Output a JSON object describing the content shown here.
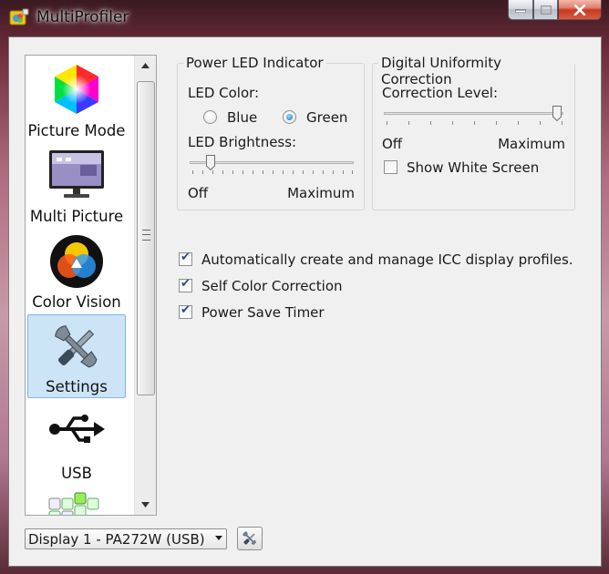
{
  "window": {
    "title": "MultiProfiler",
    "controls": {
      "minimize_icon": "minimize-icon",
      "maximize_icon": "maximize-icon",
      "close_icon": "close-icon"
    }
  },
  "nav": {
    "items": [
      {
        "label": "Picture Mode",
        "icon": "color-hexagon-icon",
        "selected": false
      },
      {
        "label": "Multi Picture",
        "icon": "monitor-icon",
        "selected": false
      },
      {
        "label": "Color Vision",
        "icon": "color-vision-icon",
        "selected": false
      },
      {
        "label": "Settings",
        "icon": "wrench-screwdriver-icon",
        "selected": true
      },
      {
        "label": "USB",
        "icon": "usb-icon",
        "selected": false
      }
    ]
  },
  "power_led": {
    "group_title": "Power LED Indicator",
    "color_label": "LED Color:",
    "options": [
      {
        "label": "Blue",
        "selected": false
      },
      {
        "label": "Green",
        "selected": true
      }
    ],
    "brightness_label": "LED Brightness:",
    "brightness_min": "Off",
    "brightness_max": "Maximum",
    "brightness_level": 0.12
  },
  "uniformity": {
    "group_title": "Digital Uniformity Correction",
    "level_label": "Correction Level:",
    "level_min": "Off",
    "level_max": "Maximum",
    "level_value": 1.0,
    "show_white_screen": {
      "label": "Show White Screen",
      "checked": false
    }
  },
  "options": [
    {
      "label": "Automatically create and manage ICC display profiles.",
      "checked": true
    },
    {
      "label": "Self Color Correction",
      "checked": true
    },
    {
      "label": "Power Save Timer",
      "checked": true
    }
  ],
  "display_select": {
    "value": "Display 1 - PA272W (USB)"
  },
  "tools_button": {
    "icon": "tools-icon"
  },
  "colors": {
    "selection_bg": "#cde4f7",
    "selection_border": "#7eb4ea",
    "close_red": "#c83a22"
  }
}
